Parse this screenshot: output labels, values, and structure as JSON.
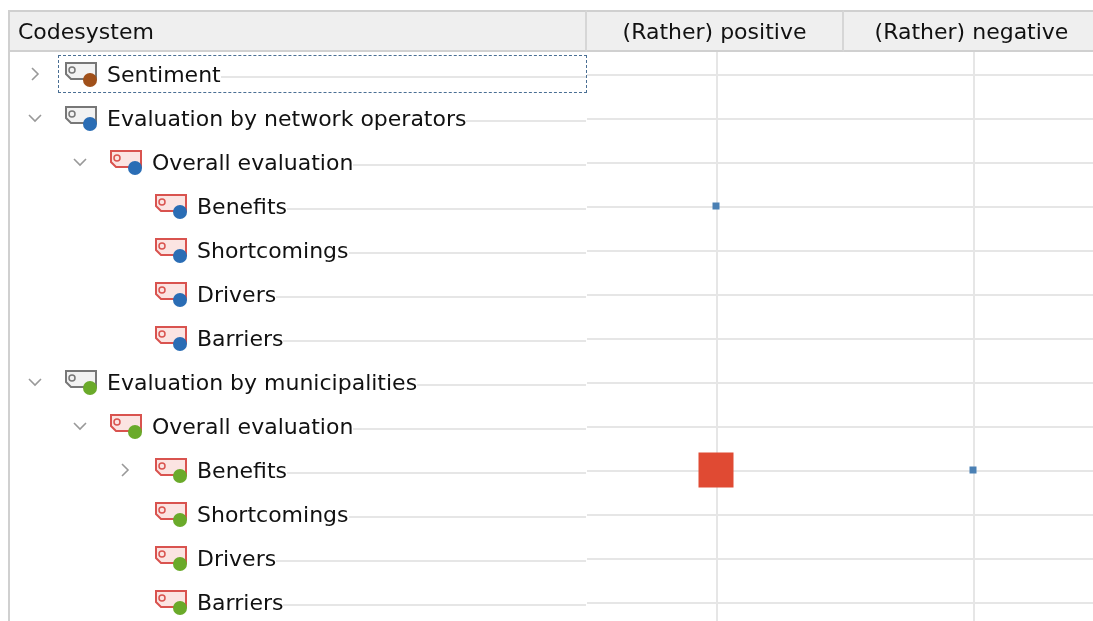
{
  "columns": [
    "Codesystem",
    "(Rather) positive",
    "(Rather) negative"
  ],
  "tree": [
    {
      "label": "Sentiment",
      "color": "#a0501a",
      "expanded": false,
      "selected": true,
      "cells": [
        {},
        {}
      ]
    },
    {
      "label": "Evaluation by network operators",
      "color": "#2a6db5",
      "expanded": true,
      "selected": false,
      "cells": [
        {},
        {}
      ],
      "children": [
        {
          "label": "Overall evaluation",
          "color": "#2a6db5",
          "expanded": true,
          "selected": false,
          "cells": [
            {},
            {}
          ],
          "children": [
            {
              "label": "Benefits",
              "color": "#2a6db5",
              "selected": false,
              "cells": [
                {
                  "kind": "small",
                  "color": "#4a80b4"
                },
                {}
              ]
            },
            {
              "label": "Shortcomings",
              "color": "#2a6db5",
              "selected": false,
              "cells": [
                {},
                {}
              ]
            },
            {
              "label": "Drivers",
              "color": "#2a6db5",
              "selected": false,
              "cells": [
                {},
                {}
              ]
            },
            {
              "label": "Barriers",
              "color": "#2a6db5",
              "selected": false,
              "cells": [
                {},
                {}
              ]
            }
          ]
        }
      ]
    },
    {
      "label": "Evaluation by municipalities",
      "color": "#6aaa2a",
      "expanded": true,
      "selected": false,
      "cells": [
        {},
        {}
      ],
      "children": [
        {
          "label": "Overall evaluation",
          "color": "#6aaa2a",
          "expanded": true,
          "selected": false,
          "cells": [
            {},
            {}
          ],
          "children": [
            {
              "label": "Benefits",
              "color": "#6aaa2a",
              "expanded": false,
              "selected": false,
              "cells": [
                {
                  "kind": "large",
                  "color": "#e04a33"
                },
                {
                  "kind": "small",
                  "color": "#4a80b4"
                }
              ]
            },
            {
              "label": "Shortcomings",
              "color": "#6aaa2a",
              "selected": false,
              "cells": [
                {},
                {}
              ]
            },
            {
              "label": "Drivers",
              "color": "#6aaa2a",
              "selected": false,
              "cells": [
                {},
                {}
              ]
            },
            {
              "label": "Barriers",
              "color": "#6aaa2a",
              "selected": false,
              "cells": [
                {},
                {}
              ]
            }
          ]
        }
      ]
    }
  ]
}
